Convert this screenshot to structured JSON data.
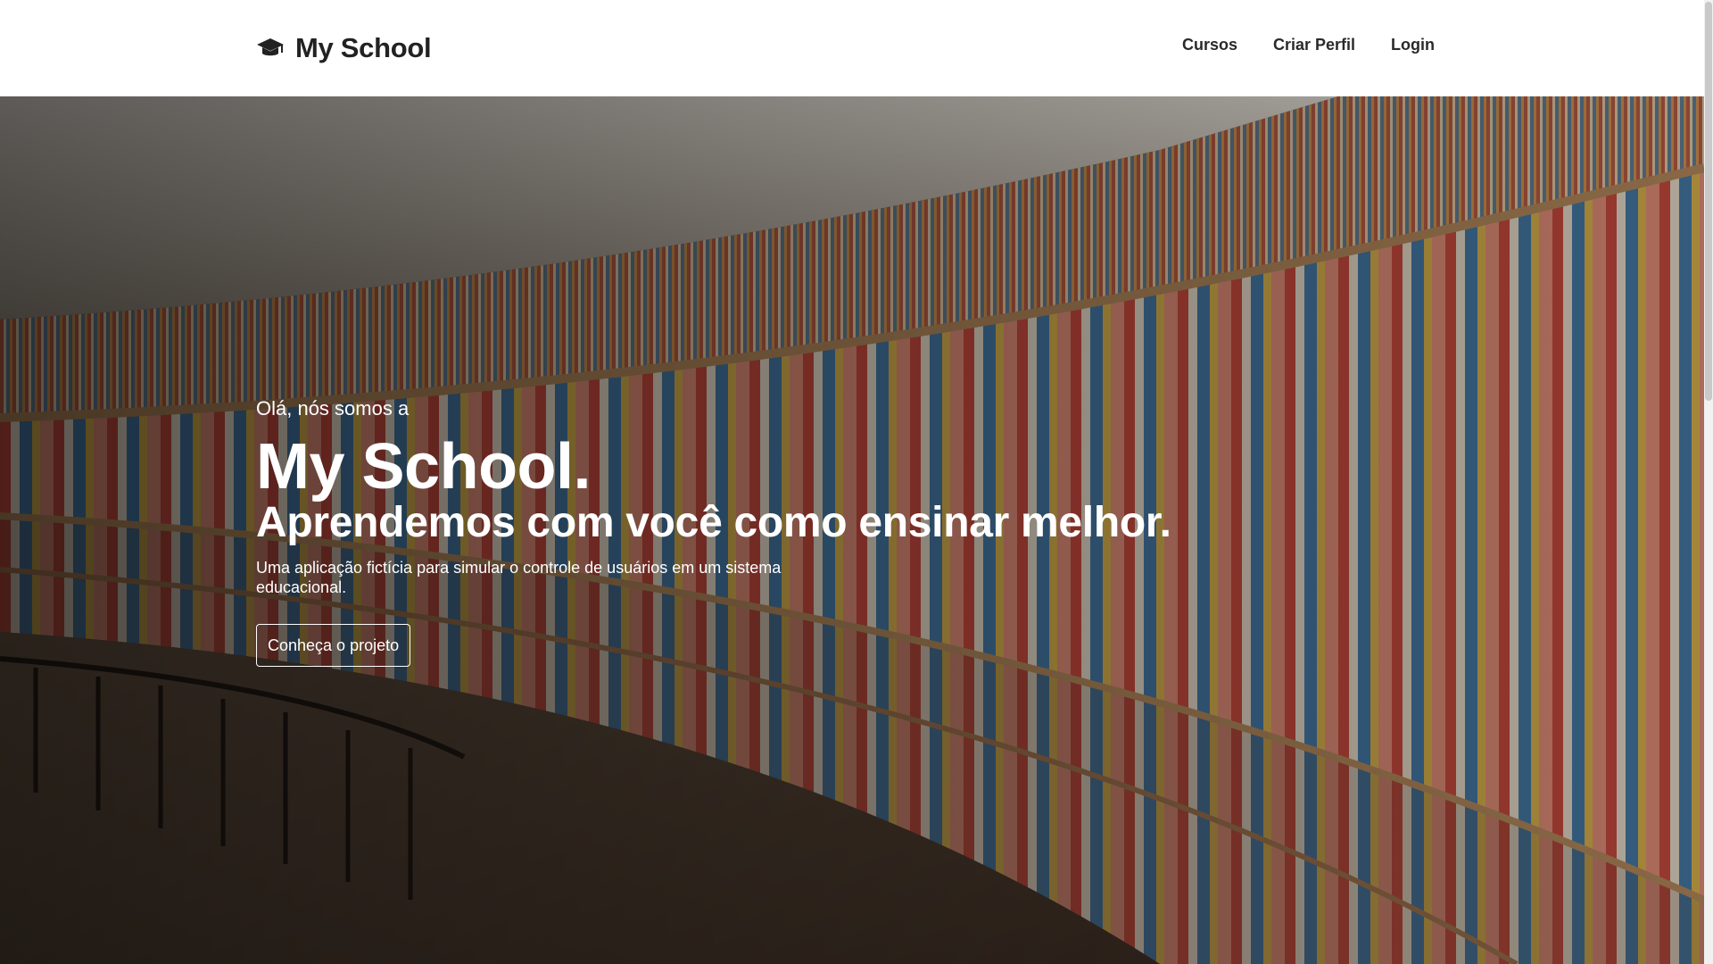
{
  "brand": {
    "name": "My School",
    "icon": "graduation-cap-icon"
  },
  "nav": {
    "items": [
      "Cursos",
      "Criar Perfil",
      "Login"
    ]
  },
  "hero": {
    "greeting": "Olá, nós somos a",
    "title": "My School.",
    "subtitle": "Aprendemos com você como ensinar melhor.",
    "description": "Uma aplicação fictícia para simular o controle de usuários em um sistema educacional.",
    "cta_label": "Conheça o projeto"
  },
  "colors": {
    "header_bg": "#ffffff",
    "header_text": "#222222",
    "hero_text": "#ffffff"
  }
}
